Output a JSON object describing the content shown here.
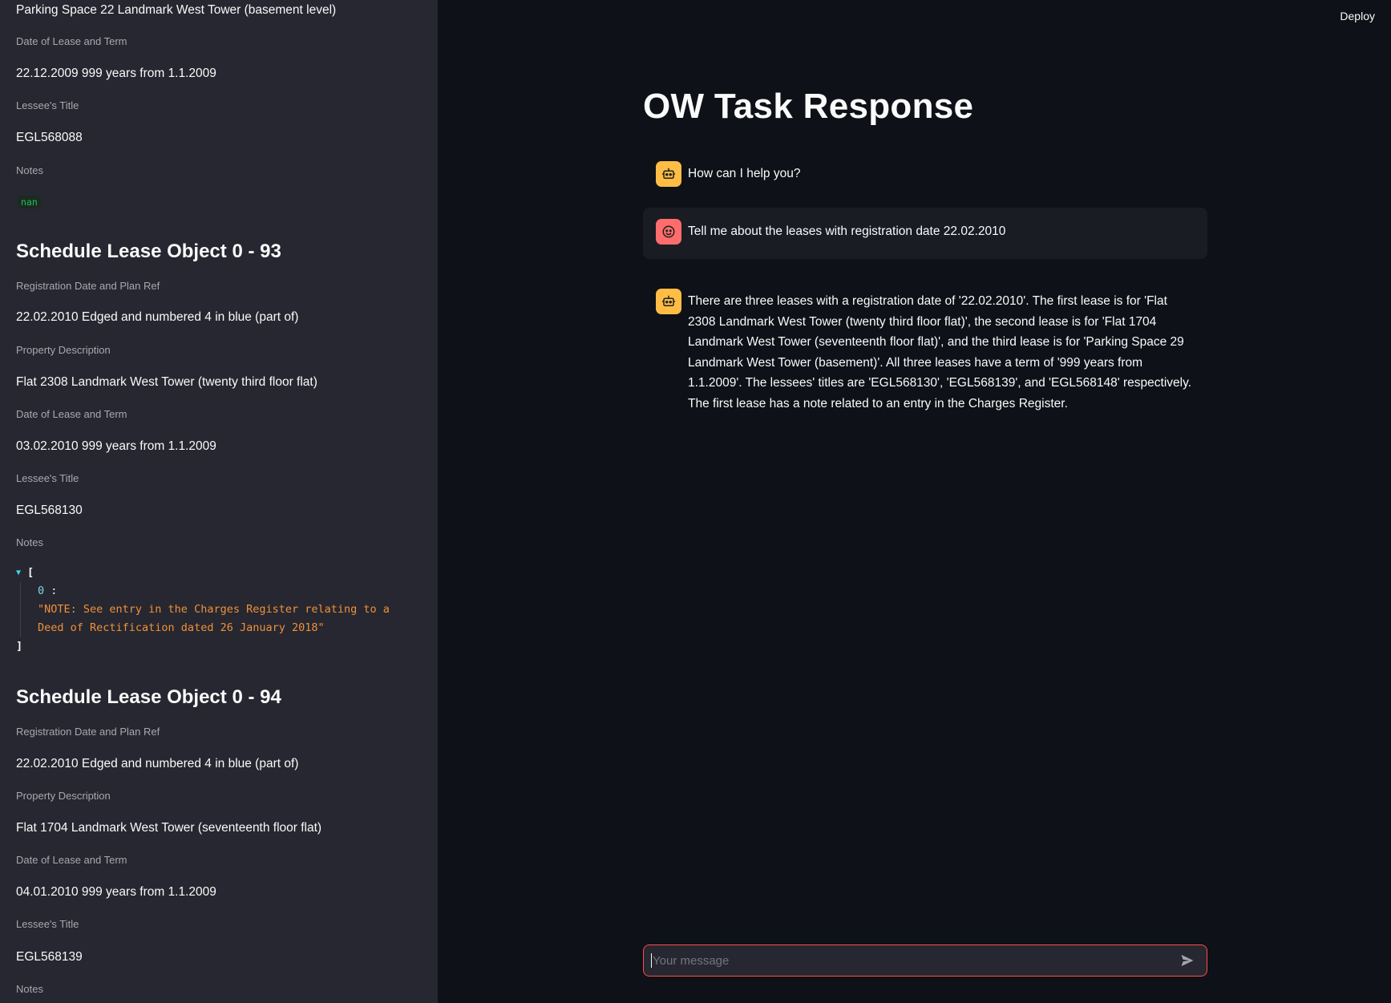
{
  "sidebar": {
    "top_value": "Parking Space 22 Landmark West Tower (basement level)",
    "top_fields": [
      {
        "label": "Date of Lease and Term",
        "value": "22.12.2009 999 years from 1.1.2009"
      },
      {
        "label": "Lessee's Title",
        "value": "EGL568088"
      },
      {
        "label": "Notes",
        "value": "nan"
      }
    ],
    "objects": [
      {
        "heading": "Schedule Lease Object 0 - 93",
        "fields": [
          {
            "label": "Registration Date and Plan Ref",
            "value": "22.02.2010 Edged and numbered 4 in blue (part of)"
          },
          {
            "label": "Property Description",
            "value": "Flat 2308 Landmark West Tower (twenty third floor flat)"
          },
          {
            "label": "Date of Lease and Term",
            "value": "03.02.2010 999 years from 1.1.2009"
          },
          {
            "label": "Lessee's Title",
            "value": "EGL568130"
          },
          {
            "label": "Notes"
          }
        ],
        "notes_json": {
          "open": "[",
          "close": "]",
          "key": "0",
          "colon": ":",
          "value": "\"NOTE: See entry in the Charges Register relating to a\nDeed of Rectification dated 26 January 2018\""
        }
      },
      {
        "heading": "Schedule Lease Object 0 - 94",
        "fields": [
          {
            "label": "Registration Date and Plan Ref",
            "value": "22.02.2010 Edged and numbered 4 in blue (part of)"
          },
          {
            "label": "Property Description",
            "value": "Flat 1704 Landmark West Tower (seventeenth floor flat)"
          },
          {
            "label": "Date of Lease and Term",
            "value": "04.01.2010 999 years from 1.1.2009"
          },
          {
            "label": "Lessee's Title",
            "value": "EGL568139"
          },
          {
            "label": "Notes"
          }
        ]
      }
    ]
  },
  "header": {
    "deploy_label": "Deploy"
  },
  "main": {
    "title": "OW Task Response",
    "messages": [
      {
        "role": "assistant",
        "text": "How can I help you?"
      },
      {
        "role": "user",
        "text": "Tell me about the leases with registration date 22.02.2010"
      },
      {
        "role": "assistant",
        "text": "There are three leases with a registration date of '22.02.2010'. The first lease is for 'Flat 2308 Landmark West Tower (twenty third floor flat)', the second lease is for 'Flat 1704 Landmark West Tower (seventeenth floor flat)', and the third lease is for 'Parking Space 29 Landmark West Tower (basement)'. All three leases have a term of '999 years from 1.1.2009'. The lessees' titles are 'EGL568130', 'EGL568139', and 'EGL568148' respectively. The first lease has a note related to an entry in the Charges Register."
      }
    ],
    "input": {
      "placeholder": "Your message",
      "value": ""
    }
  },
  "icons": {
    "assistant_avatar": "robot-icon",
    "user_avatar": "face-icon",
    "send": "send-icon",
    "json_toggle": "caret-down-icon"
  },
  "colors": {
    "accent": "#ff4b4b",
    "assistant_avatar": "#ffbd45",
    "user_avatar": "#ff6c6c",
    "sidebar_bg": "#262730",
    "main_bg": "#0e1117"
  }
}
